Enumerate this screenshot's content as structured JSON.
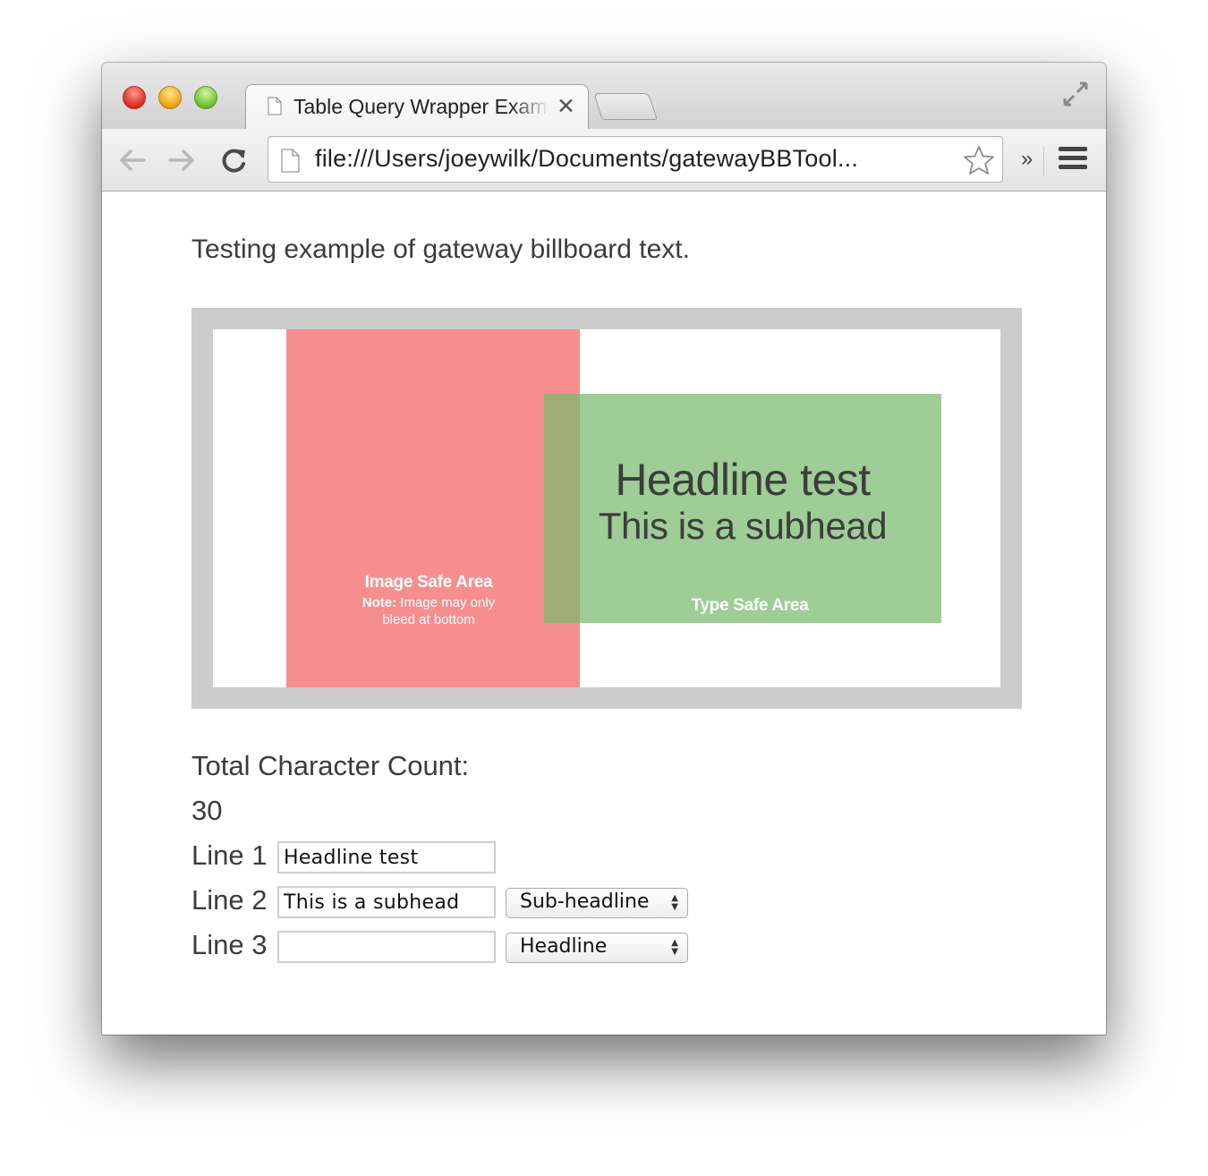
{
  "browser": {
    "tab_title": "Table Query Wrapper Exam",
    "tab_close": "✕",
    "url": "file:///Users/joeywilk/Documents/gatewayBBTool...",
    "overflow_label": "»"
  },
  "page": {
    "intro": "Testing example of gateway billboard text.",
    "billboard": {
      "image_safe_title": "Image Safe Area",
      "image_safe_note_bold": "Note:",
      "image_safe_note_line1": " Image may only",
      "image_safe_note_line2": "bleed at bottom",
      "type_safe_label": "Type Safe Area",
      "headline": "Headline test",
      "subhead": "This is a subhead",
      "colors": {
        "frame": "#cccccc",
        "image_safe": "#f46666",
        "type_safe": "#78ba6e"
      }
    },
    "count_label": "Total Character Count:",
    "count_value": "30",
    "lines": [
      {
        "label": "Line 1",
        "value": "Headline test"
      },
      {
        "label": "Line 2",
        "value": "This is a subhead",
        "select": "Sub-headline"
      },
      {
        "label": "Line 3",
        "value": "",
        "select": "Headline"
      }
    ]
  }
}
